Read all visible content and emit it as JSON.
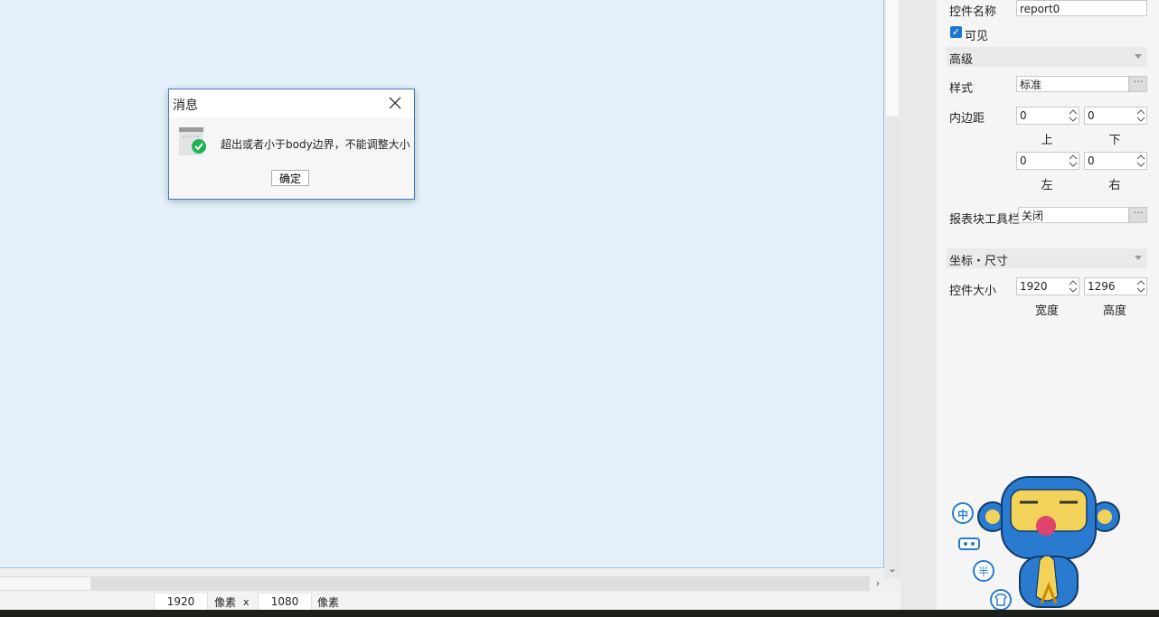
{
  "dialog": {
    "title": "消息",
    "message": "超出或者小于body边界，不能调整大小",
    "ok_label": "确定",
    "icon": "success-check-icon"
  },
  "status": {
    "width": "1920",
    "width_unit": "像素",
    "separator": "x",
    "height": "1080",
    "height_unit": "像素"
  },
  "panel": {
    "control_name_label": "控件名称",
    "control_name_value": "report0",
    "visible_label": "可见",
    "advanced_section": "高级",
    "style_label": "样式",
    "style_value": "标准",
    "padding_label": "内边距",
    "padding": {
      "top": "0",
      "top_label": "上",
      "bottom": "0",
      "bottom_label": "下",
      "left": "0",
      "left_label": "左",
      "right": "0",
      "right_label": "右"
    },
    "toolbar_label": "报表块工具栏",
    "toolbar_value": "关闭",
    "coords_section": "坐标・尺寸",
    "size_label": "控件大小",
    "width_value": "1920",
    "width_label": "宽度",
    "height_value": "1296",
    "height_label": "高度",
    "more_glyph": "···"
  },
  "mascot_badges": [
    "中"
  ],
  "colors": {
    "canvas": "#e4f1fa",
    "dialog_border": "#3e7ec4",
    "check_green": "#1fb355",
    "checkbox_blue": "#1e78d2",
    "mascot_blue": "#2a7bd0",
    "mascot_face": "#f3d25a"
  }
}
